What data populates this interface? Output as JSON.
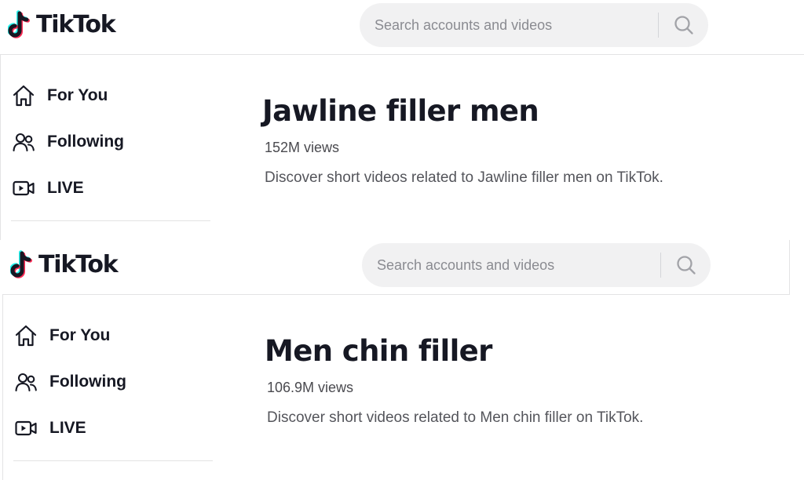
{
  "brand": {
    "name": "TikTok"
  },
  "search": {
    "placeholder": "Search accounts and videos"
  },
  "nav": [
    {
      "label": "For You",
      "icon": "home-icon"
    },
    {
      "label": "Following",
      "icon": "users-icon"
    },
    {
      "label": "LIVE",
      "icon": "live-icon"
    }
  ],
  "results": [
    {
      "title": "Jawline filler men",
      "views": "152M views",
      "description": "Discover short videos related to Jawline filler men on TikTok."
    },
    {
      "title": "Men chin filler",
      "views": "106.9M views",
      "description": "Discover short videos related to Men chin filler on TikTok."
    }
  ],
  "colors": {
    "text": "#161823",
    "cyan": "#25f4ee",
    "red": "#fe2c55",
    "search_bg": "#f1f1f2"
  }
}
